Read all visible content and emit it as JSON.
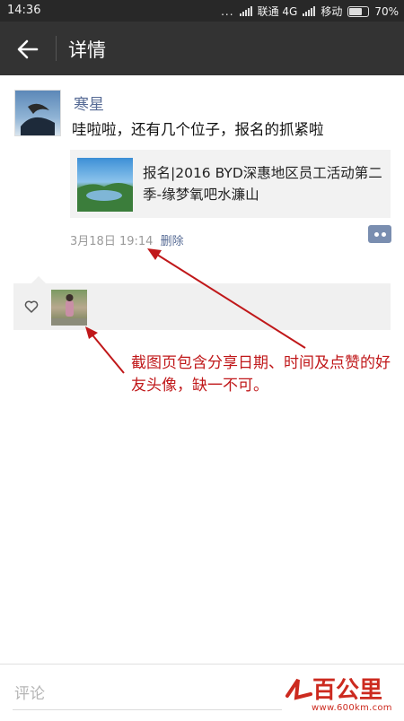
{
  "status": {
    "time": "14:36",
    "dots": "...",
    "carrier1": "联通 4G",
    "carrier2": "移动",
    "battery": "70%"
  },
  "header": {
    "title": "详情"
  },
  "post": {
    "author": "寒星",
    "text": "哇啦啦，还有几个位子，报名的抓紧啦",
    "share_title": "报名|2016 BYD深惠地区员工活动第二季-缘梦氧吧水濂山",
    "date": "3月18日 19:14",
    "delete_label": "删除"
  },
  "annotation": {
    "text": "截图页包含分享日期、时间及点赞的好友头像，缺一不可。"
  },
  "comment": {
    "placeholder": "评论"
  },
  "watermark": {
    "brand": "百公里",
    "url": "www.600km.com"
  },
  "colors": {
    "title_bar": "#333333",
    "link": "#576b95",
    "annotation": "#c0181a"
  }
}
